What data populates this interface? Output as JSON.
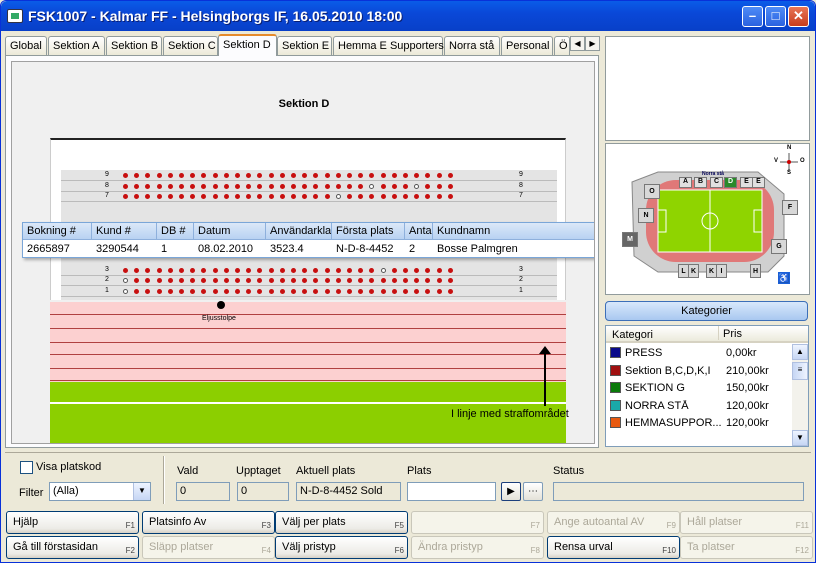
{
  "window": {
    "title": "FSK1007 - Kalmar FF - Helsingborgs IF, 16.05.2010 18:00"
  },
  "tabs": [
    {
      "label": "Global"
    },
    {
      "label": "Sektion A"
    },
    {
      "label": "Sektion B"
    },
    {
      "label": "Sektion C"
    },
    {
      "label": "Sektion D"
    },
    {
      "label": "Sektion E"
    },
    {
      "label": "Hemma E Supporters"
    },
    {
      "label": "Norra stå"
    },
    {
      "label": "Personal"
    },
    {
      "label": "Ö"
    }
  ],
  "active_tab": "Sektion D",
  "section_map": {
    "title": "Sektion D",
    "row_numbers_top": [
      "9",
      "8",
      "7"
    ],
    "row_numbers_bottom": [
      "3",
      "2",
      "1"
    ],
    "pole_label": "Eljusstolpe",
    "arrow_label": "I linje med straffområdet"
  },
  "booking_popup": {
    "columns": [
      "Bokning #",
      "Kund #",
      "DB #",
      "Datum",
      "Användarkla",
      "Första plats",
      "Anta",
      "Kundnamn"
    ],
    "row": [
      "2665897",
      "3290544",
      "1",
      "08.02.2010",
      "3523.4",
      "N-D-8-4452",
      "2",
      "Bosse Palmgren"
    ]
  },
  "stadium": {
    "compass": [
      "N",
      "V",
      "O",
      "S"
    ],
    "labels_top": [
      "A",
      "B",
      "C",
      "D",
      "E",
      "E"
    ],
    "norra_label": "Norra stå",
    "labels_side": [
      "O",
      "N",
      "M",
      "F",
      "G"
    ],
    "labels_bottom": [
      "L",
      "K",
      "K",
      "I",
      "H"
    ],
    "wheelchair": "♿"
  },
  "kategorier": {
    "button": "Kategorier",
    "col_name": "Kategori",
    "col_price": "Pris",
    "items": [
      {
        "name": "PRESS",
        "price": "0,00kr",
        "color": "#0a0a8a"
      },
      {
        "name": "Sektion B,C,D,K,I",
        "price": "210,00kr",
        "color": "#a01010"
      },
      {
        "name": "SEKTION G",
        "price": "150,00kr",
        "color": "#0a7a0a"
      },
      {
        "name": "NORRA STÅ",
        "price": "120,00kr",
        "color": "#1aa8a8"
      },
      {
        "name": "HEMMASUPPOR...",
        "price": "120,00kr",
        "color": "#e85a10"
      }
    ]
  },
  "footer": {
    "visa_platskod": "Visa platskod",
    "filter_label": "Filter",
    "filter_value": "(Alla)",
    "vald_label": "Vald",
    "vald_value": "0",
    "upptaget_label": "Upptaget",
    "upptaget_value": "0",
    "aktuell_label": "Aktuell plats",
    "aktuell_value": "N-D-8-4452 Sold",
    "plats_label": "Plats",
    "plats_value": "",
    "status_label": "Status",
    "status_value": ""
  },
  "function_buttons": [
    {
      "label": "Hjälp",
      "key": "F1",
      "enabled": true
    },
    {
      "label": "Platsinfo Av",
      "key": "F3",
      "enabled": true
    },
    {
      "label": "Välj per plats",
      "key": "F5",
      "enabled": true
    },
    {
      "label": "",
      "key": "F7",
      "enabled": false
    },
    {
      "label": "Ange autoantal AV",
      "key": "F9",
      "enabled": false
    },
    {
      "label": "Håll platser",
      "key": "F11",
      "enabled": false
    },
    {
      "label": "Gå till förstasidan",
      "key": "F2",
      "enabled": true
    },
    {
      "label": "Släpp platser",
      "key": "F4",
      "enabled": false
    },
    {
      "label": "Välj pristyp",
      "key": "F6",
      "enabled": true
    },
    {
      "label": "Ändra pristyp",
      "key": "F8",
      "enabled": false
    },
    {
      "label": "Rensa urval",
      "key": "F10",
      "enabled": true
    },
    {
      "label": "Ta platser",
      "key": "F12",
      "enabled": false
    }
  ]
}
